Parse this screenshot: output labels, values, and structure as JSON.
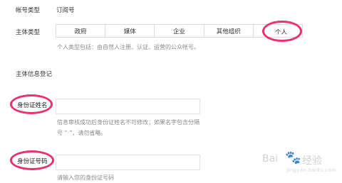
{
  "account_type": {
    "label": "帐号类型",
    "value": "订阅号"
  },
  "subject_type": {
    "label": "主体类型",
    "options": [
      "政府",
      "媒体",
      "企业",
      "其他组织",
      "个人"
    ],
    "selected": "个人",
    "hint": "个人类型包括：由自然人注册、认证、运营的公众帐号。"
  },
  "section_title": "主体信息登记",
  "id_name": {
    "label": "身份证姓名",
    "hint_line1": "信息审核成功后身份证姓名不可修改；如果名字包含分隔",
    "hint_line2": "号 “·”，请勿省略。"
  },
  "id_number": {
    "label": "身份证号码",
    "hint": "请输入您的身份证号码"
  },
  "watermark": {
    "text1": "Bai",
    "text2": "经验",
    "url": "jingyan.baidu.com"
  },
  "colors": {
    "highlight_ring": "#e8316d",
    "hint_text": "#8a8a8a",
    "border": "#dcdcdc"
  }
}
